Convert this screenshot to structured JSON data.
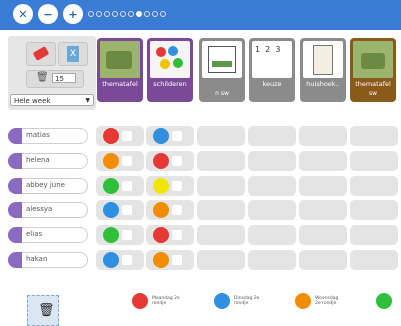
{
  "toolbar": {
    "close_icon": "x-icon",
    "zoom_out_icon": "zoom-out-icon",
    "zoom_in_icon": "zoom-in-icon",
    "page_dots_total": 10,
    "page_dots_active": 7
  },
  "tools": {
    "eraser_icon": "eraser-icon",
    "excel_icon": "excel-icon",
    "bin_value": "15",
    "week_select": "Hele week"
  },
  "activities": [
    {
      "label": "thematafel",
      "sub": "",
      "color": "#7a4a98"
    },
    {
      "label": "schilderen",
      "sub": "",
      "color": "#7a4a98"
    },
    {
      "label": "",
      "sub": "n sw",
      "color": "#8b8b8b"
    },
    {
      "label": "keuze",
      "sub": "",
      "color": "#8b8b8b"
    },
    {
      "label": "huishoek..",
      "sub": "",
      "color": "#8b8b8b"
    },
    {
      "label": "thematafel",
      "sub": "sw",
      "color": "#8a5a1a"
    }
  ],
  "children": [
    {
      "name": "matias",
      "c1": "#e53935",
      "c2": "#2f8fe0"
    },
    {
      "name": "helena",
      "c1": "#f28c00",
      "c2": "#e53935"
    },
    {
      "name": "abbey june",
      "c1": "#2fbf3a",
      "c2": "#f2e600"
    },
    {
      "name": "alessya",
      "c1": "#2f8fe0",
      "c2": "#f28c00"
    },
    {
      "name": "elias",
      "c1": "#2fbf3a",
      "c2": "#e53935"
    },
    {
      "name": "hakan",
      "c1": "#2f8fe0",
      "c2": "#f28c00"
    }
  ],
  "legend": [
    {
      "color": "#e53935",
      "text": "Maandag 2e rondje"
    },
    {
      "color": "#2f8fe0",
      "text": "Dinsdag 2e rondje"
    },
    {
      "color": "#f28c00",
      "text": "Woensdag 2e rondje"
    },
    {
      "color": "#2fbf3a",
      "text": ""
    }
  ],
  "trash_icon": "trash-icon"
}
